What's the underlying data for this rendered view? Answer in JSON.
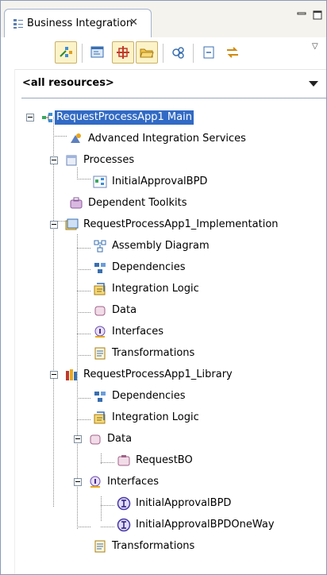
{
  "view": {
    "tab_title": "Business Integration",
    "tab_icon": "business-integration-view-icon",
    "close_glyph": "✕"
  },
  "toolbar": {
    "buttons": [
      {
        "name": "link-with-editor-icon",
        "pressed": true
      },
      {
        "name": "new-module-icon",
        "pressed": false
      },
      {
        "name": "show-solutions-icon",
        "pressed": true
      },
      {
        "name": "show-folders-icon",
        "pressed": true
      },
      {
        "name": "show-references-icon",
        "pressed": false
      },
      {
        "name": "collapse-all-icon",
        "pressed": false
      },
      {
        "name": "sync-icon",
        "pressed": false
      }
    ],
    "menu_glyph": "▽"
  },
  "resources": {
    "label": "<all resources>"
  },
  "tree": {
    "items": [
      {
        "label": "RequestProcessApp1 Main",
        "icon": "process-app-icon",
        "selected": true
      },
      {
        "label": "Advanced Integration Services",
        "icon": "advanced-integration-services-icon"
      },
      {
        "label": "Processes",
        "icon": "processes-folder-icon"
      },
      {
        "label": "InitialApprovalBPD",
        "icon": "bpd-icon"
      },
      {
        "label": "Dependent Toolkits",
        "icon": "toolkits-icon"
      },
      {
        "label": "RequestProcessApp1_Implementation",
        "icon": "implementation-module-icon"
      },
      {
        "label": "Assembly Diagram",
        "icon": "assembly-diagram-icon"
      },
      {
        "label": "Dependencies",
        "icon": "dependencies-icon"
      },
      {
        "label": "Integration Logic",
        "icon": "integration-logic-icon"
      },
      {
        "label": "Data",
        "icon": "data-folder-icon"
      },
      {
        "label": "Interfaces",
        "icon": "interfaces-icon"
      },
      {
        "label": "Transformations",
        "icon": "transformations-icon"
      },
      {
        "label": "RequestProcessApp1_Library",
        "icon": "library-icon"
      },
      {
        "label": "Dependencies",
        "icon": "dependencies-icon"
      },
      {
        "label": "Integration Logic",
        "icon": "integration-logic-icon"
      },
      {
        "label": "Data",
        "icon": "data-folder-icon"
      },
      {
        "label": "RequestBO",
        "icon": "business-object-icon"
      },
      {
        "label": "Interfaces",
        "icon": "interfaces-icon"
      },
      {
        "label": "InitialApprovalBPD",
        "icon": "interface-icon"
      },
      {
        "label": "InitialApprovalBPDOneWay",
        "icon": "interface-icon"
      },
      {
        "label": "Transformations",
        "icon": "transformations-icon"
      }
    ]
  }
}
